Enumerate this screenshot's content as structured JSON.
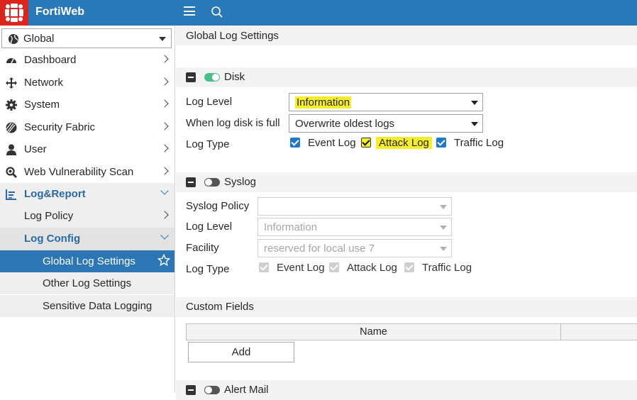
{
  "app": {
    "brand": "FortiWeb"
  },
  "sidebar": {
    "vdom": "Global",
    "items": [
      {
        "label": "Dashboard"
      },
      {
        "label": "Network"
      },
      {
        "label": "System"
      },
      {
        "label": "Security Fabric"
      },
      {
        "label": "User"
      },
      {
        "label": "Web Vulnerability Scan"
      },
      {
        "label": "Log&Report"
      }
    ],
    "sub": [
      {
        "label": "Log Policy"
      },
      {
        "label": "Log Config"
      }
    ],
    "leaves": [
      {
        "label": "Global Log Settings"
      },
      {
        "label": "Other Log Settings"
      },
      {
        "label": "Sensitive Data Logging"
      }
    ]
  },
  "main": {
    "title": "Global Log Settings",
    "disk": {
      "title": "Disk",
      "enabled": true,
      "log_level_label": "Log Level",
      "log_level": "Information",
      "full_label": "When log disk is full",
      "full_value": "Overwrite oldest logs",
      "log_type_label": "Log Type",
      "types": [
        "Event Log",
        "Attack Log",
        "Traffic Log"
      ]
    },
    "syslog": {
      "title": "Syslog",
      "enabled": false,
      "policy_label": "Syslog Policy",
      "policy_value": "",
      "log_level_label": "Log Level",
      "log_level": "Information",
      "facility_label": "Facility",
      "facility": "reserved for local use 7",
      "log_type_label": "Log Type",
      "types": [
        "Event Log",
        "Attack Log",
        "Traffic Log"
      ]
    },
    "custom_fields": {
      "title": "Custom Fields",
      "column": "Name",
      "add_label": "Add"
    },
    "alert_mail": {
      "title": "Alert Mail"
    }
  },
  "colors": {
    "topbar": "#2979b8",
    "logo": "#d9251c",
    "active": "#2c76b6",
    "highlight": "#f6ee2a",
    "toggle_on": "#4bbf8a"
  }
}
